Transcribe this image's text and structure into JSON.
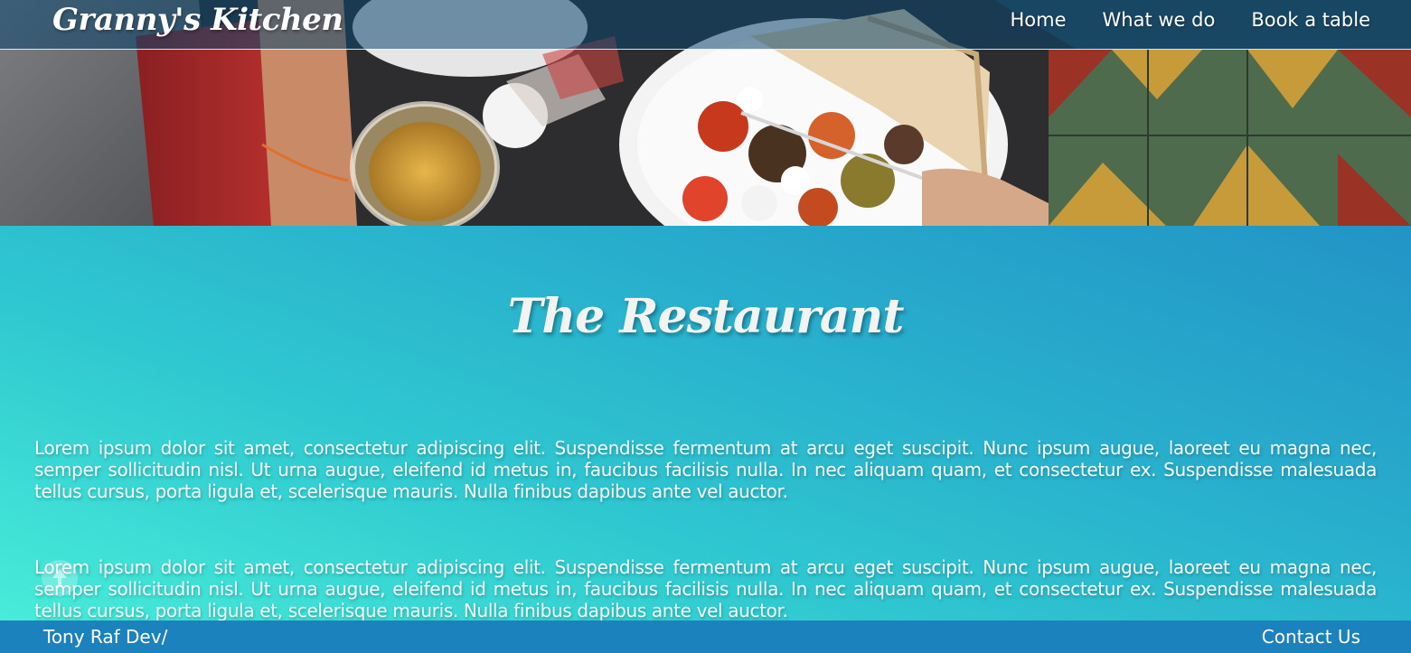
{
  "header": {
    "brand": "Granny's Kitchen",
    "nav": [
      "Home",
      "What we do",
      "Book a table"
    ]
  },
  "main": {
    "title": "The Restaurant",
    "paragraphs": [
      "Lorem ipsum dolor sit amet, consectetur adipiscing elit. Suspendisse fermentum at arcu eget suscipit. Nunc ipsum augue, laoreet eu magna nec, semper sollicitudin nisl. Ut urna augue, eleifend id metus in, faucibus facilisis nulla. In nec aliquam quam, et consectetur ex. Suspendisse malesuada tellus cursus, porta ligula et, scelerisque mauris. Nulla finibus dapibus ante vel auctor.",
      "Lorem ipsum dolor sit amet, consectetur adipiscing elit. Suspendisse fermentum at arcu eget suscipit. Nunc ipsum augue, laoreet eu magna nec, semper sollicitudin nisl. Ut urna augue, eleifend id metus in, faucibus facilisis nulla. In nec aliquam quam, et consectetur ex. Suspendisse malesuada tellus cursus, porta ligula et, scelerisque mauris. Nulla finibus dapibus ante vel auctor."
    ]
  },
  "footer": {
    "left": "Tony Raf Dev/",
    "right": "Contact Us"
  },
  "icons": {
    "scroll_top": "arrow-up-icon"
  },
  "colors": {
    "navbar": "#0a466e",
    "footer": "#1c82bd",
    "gradient_start": "#48ecd9",
    "gradient_end": "#2294c6"
  }
}
